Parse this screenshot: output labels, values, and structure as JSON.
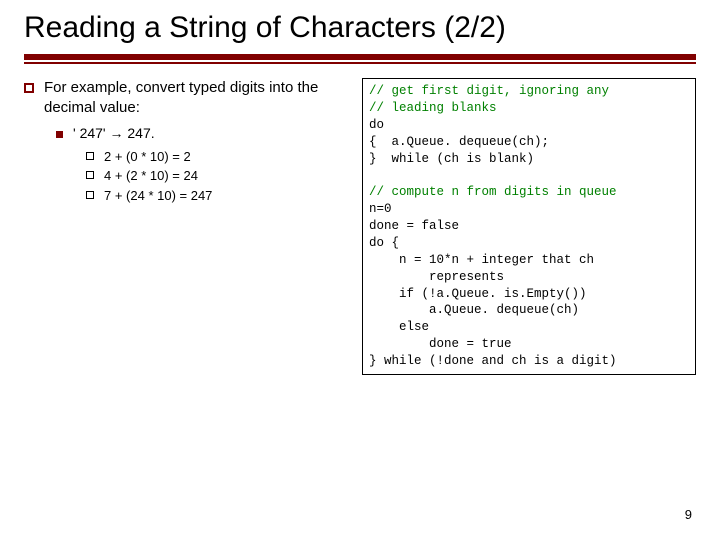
{
  "title": "Reading a String of Characters (2/2)",
  "body": {
    "intro": "For example, convert typed digits into the decimal value:",
    "example_label": "' 247' → 247.",
    "steps": [
      "2 + (0   * 10) = 2",
      "4 + (2   * 10) = 24",
      "7 + (24 * 10) = 247"
    ]
  },
  "code": {
    "c1": "// get first digit, ignoring any",
    "c2": "// leading blanks",
    "l3": "do",
    "l4": "{  a.Queue. dequeue(ch);",
    "l5": "}  while (ch is blank)",
    "blank1": "",
    "c6": "// compute n from digits in queue",
    "l7": "n=0",
    "l8": "done = false",
    "l9": "do {",
    "l10": "    n = 10*n + integer that ch",
    "l11": "        represents",
    "l12": "    if (!a.Queue. is.Empty())",
    "l13": "        a.Queue. dequeue(ch)",
    "l14": "    else",
    "l15": "        done = true",
    "l16": "} while (!done and ch is a digit)"
  },
  "page_number": "9"
}
